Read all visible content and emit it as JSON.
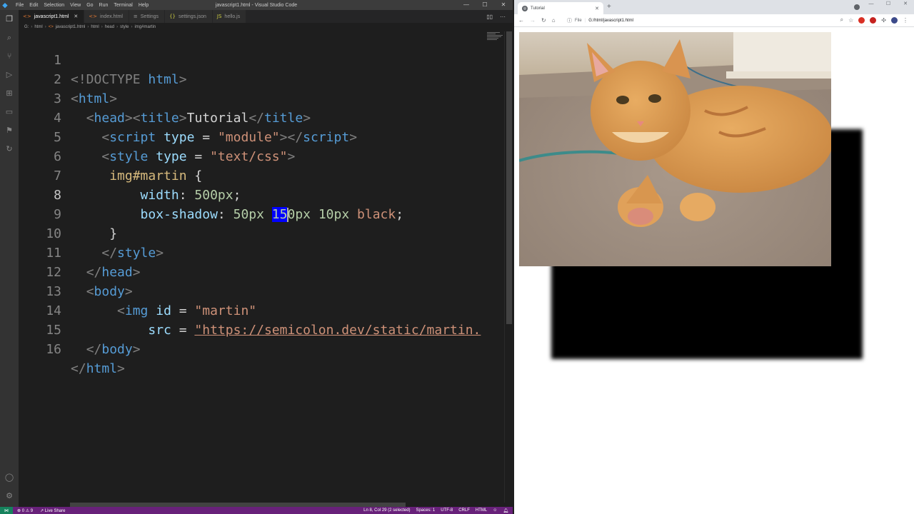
{
  "vscode": {
    "menu": [
      "File",
      "Edit",
      "Selection",
      "View",
      "Go",
      "Run",
      "Terminal",
      "Help"
    ],
    "window_title": "javascript1.html - Visual Studio Code",
    "tabs": [
      {
        "label": "javascript1.html",
        "icon": "html-file-icon",
        "active": true
      },
      {
        "label": "index.html",
        "icon": "html-file-icon",
        "active": false
      },
      {
        "label": "Settings",
        "icon": "gear-icon",
        "active": false
      },
      {
        "label": "settings.json",
        "icon": "json-file-icon",
        "active": false
      },
      {
        "label": "hello.js",
        "icon": "js-file-icon",
        "active": false
      }
    ],
    "breadcrumb": [
      "G:",
      "html",
      "javascript1.html",
      "html",
      "head",
      "style",
      "img#martin"
    ],
    "code_lines": [
      "1",
      "2",
      "3",
      "4",
      "5",
      "6",
      "7",
      "8",
      "9",
      "10",
      "11",
      "12",
      "13",
      "14",
      "15",
      "16"
    ],
    "code": {
      "l1_doctype": "<!DOCTYPE",
      "l1_html": " html",
      "l1_close": ">",
      "l2_open": "<",
      "l2_tag": "html",
      "l2_close": ">",
      "l3_a": "<",
      "l3_head": "head",
      "l3_b": "><",
      "l3_title": "title",
      "l3_c": ">",
      "l3_text": "Tutorial",
      "l3_d": "</",
      "l3_title2": "title",
      "l3_e": ">",
      "l4_a": "<",
      "l4_script": "script",
      "l4_type": " type",
      "l4_eq": " = ",
      "l4_val": "\"module\"",
      "l4_b": "></",
      "l4_script2": "script",
      "l4_c": ">",
      "l5_a": "<",
      "l5_style": "style",
      "l5_type": " type",
      "l5_eq": " = ",
      "l5_val": "\"text/css\"",
      "l5_b": ">",
      "l6_sel": "img#martin",
      "l6_brace": " {",
      "l7_prop": "width",
      "l7_colon": ": ",
      "l7_val": "500px",
      "l7_semi": ";",
      "l8_prop": "box-shadow",
      "l8_colon": ": ",
      "l8_v1": "50px ",
      "l8_sel": "15",
      "l8_v2": "0px 10px ",
      "l8_v3": "black",
      "l8_semi": ";",
      "l9": "}",
      "l10_a": "</",
      "l10_style": "style",
      "l10_b": ">",
      "l11_a": "</",
      "l11_head": "head",
      "l11_b": ">",
      "l12_a": "<",
      "l12_body": "body",
      "l12_b": ">",
      "l13_a": "<",
      "l13_img": "img",
      "l13_id": " id",
      "l13_eq": " = ",
      "l13_val": "\"martin\"",
      "l14_src": "src",
      "l14_eq": " = ",
      "l14_val": "\"https://semicolon.dev/static/martin.",
      "l15_a": "</",
      "l15_body": "body",
      "l15_b": ">",
      "l16_a": "</",
      "l16_html": "html",
      "l16_b": ">"
    },
    "status": {
      "remote": "⋈",
      "problems": "⊗ 0 ⚠ 9",
      "live_share": "Live Share",
      "position": "Ln 8, Col 29 (2 selected)",
      "spaces": "Spaces: 1",
      "encoding": "UTF-8",
      "eol": "CRLF",
      "language": "HTML"
    }
  },
  "chrome": {
    "tab_title": "Tutorial",
    "url_scheme": "File",
    "url": "G:/html/javascript1.html"
  }
}
